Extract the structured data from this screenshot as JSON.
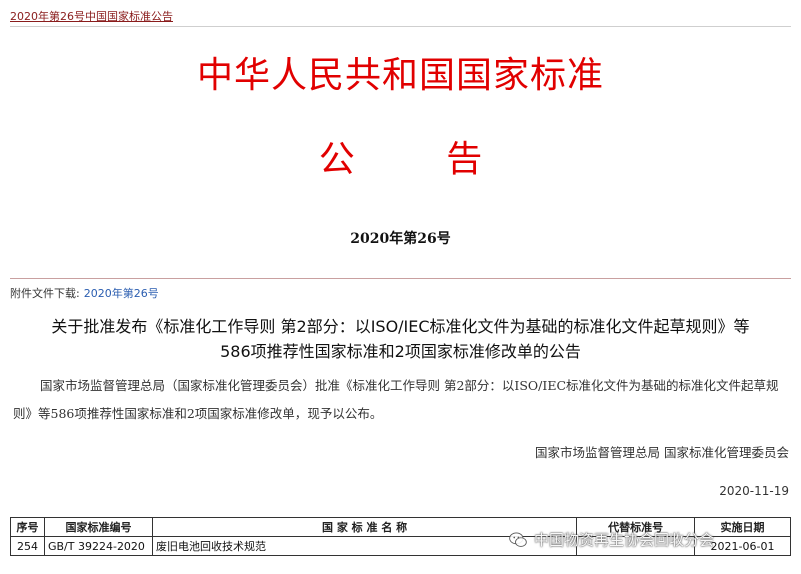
{
  "breadcrumb": {
    "link": "2020年第26号中国国家标准公告"
  },
  "header": {
    "gov_title": "中华人民共和国国家标准",
    "notice": "公 告",
    "issue_no": "2020年第26号"
  },
  "attachment": {
    "label": "附件文件下载:",
    "link": "2020年第26号"
  },
  "headline": {
    "line1": "关于批准发布《标准化工作导则 第2部分：以ISO/IEC标准化文件为基础的标准化文件起草规则》等",
    "line2": "586项推荐性国家标准和2项国家标准修改单的公告"
  },
  "body": "国家市场监督管理总局（国家标准化管理委员会）批准《标准化工作导则 第2部分：以ISO/IEC标准化文件为基础的标准化文件起草规则》等586项推荐性国家标准和2项国家标准修改单，现予以公布。",
  "signer": "国家市场监督管理总局 国家标准化管理委员会",
  "sign_date": "2020-11-19",
  "table": {
    "headers": {
      "no": "序号",
      "code": "国家标准编号",
      "name": "国 家 标 准 名 称",
      "replaces": "代替标准号",
      "date": "实施日期"
    },
    "rows": [
      {
        "no": "254",
        "code": "GB/T 39224-2020",
        "name": "废旧电池回收技术规范",
        "replaces": "",
        "date": "2021-06-01"
      }
    ]
  },
  "watermark": {
    "text": "中国物资再生协会回收分会",
    "icon": "wechat-icon"
  }
}
